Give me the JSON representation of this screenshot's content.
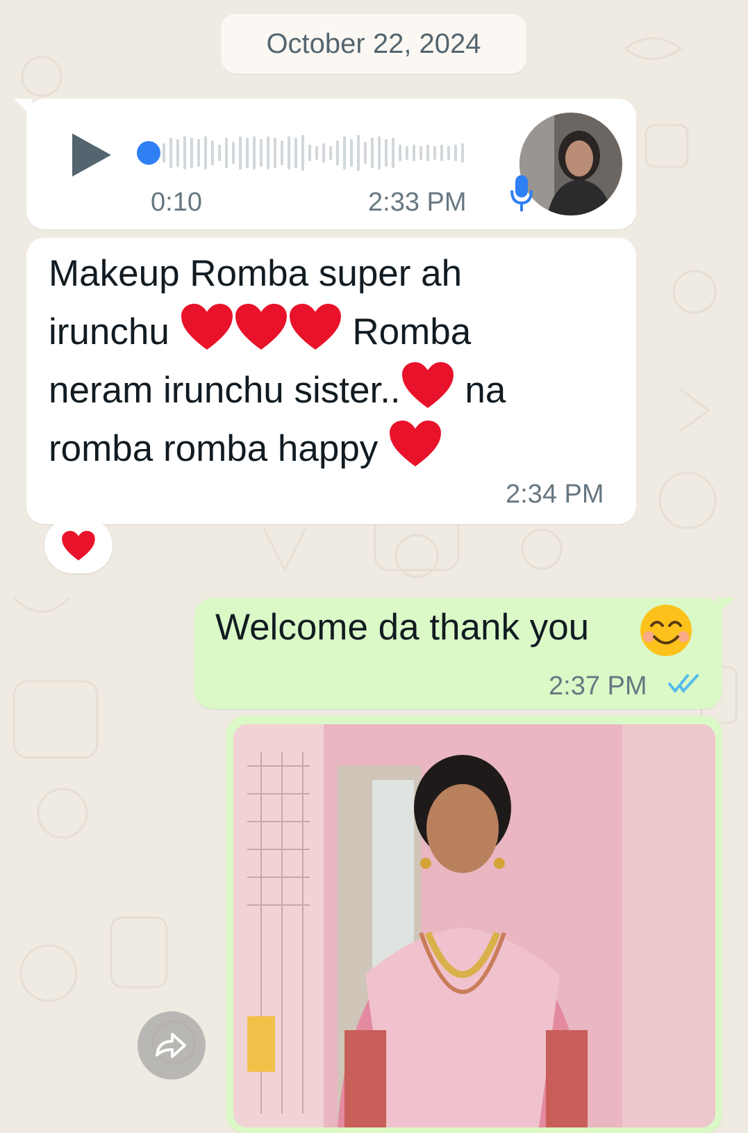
{
  "chat": {
    "date_separator": "October 22, 2024",
    "voice_message": {
      "duration": "0:10",
      "time": "2:33 PM",
      "progress": 0.0,
      "sender_avatar_icon": "profile-photo",
      "mic_icon": "microphone-icon"
    },
    "text_message_in": {
      "line1": "Makeup Romba super ah",
      "line2a": "irunchu",
      "line2b": "Romba",
      "line3a": "neram irunchu sister..",
      "line3b": "na",
      "line4": "romba romba happy",
      "time": "2:34 PM",
      "reaction": "❤️"
    },
    "text_message_out": {
      "text": "Welcome da thank you",
      "emoji": "😊",
      "time": "2:37 PM",
      "status": "read"
    },
    "image_message": {
      "forward_icon": "forward-icon"
    },
    "colors": {
      "incoming_bubble": "#ffffff",
      "outgoing_bubble": "#dbf8c7",
      "background": "#efeae2",
      "accent_blue": "#2f7ff5",
      "read_ticks": "#53bdeb"
    }
  }
}
